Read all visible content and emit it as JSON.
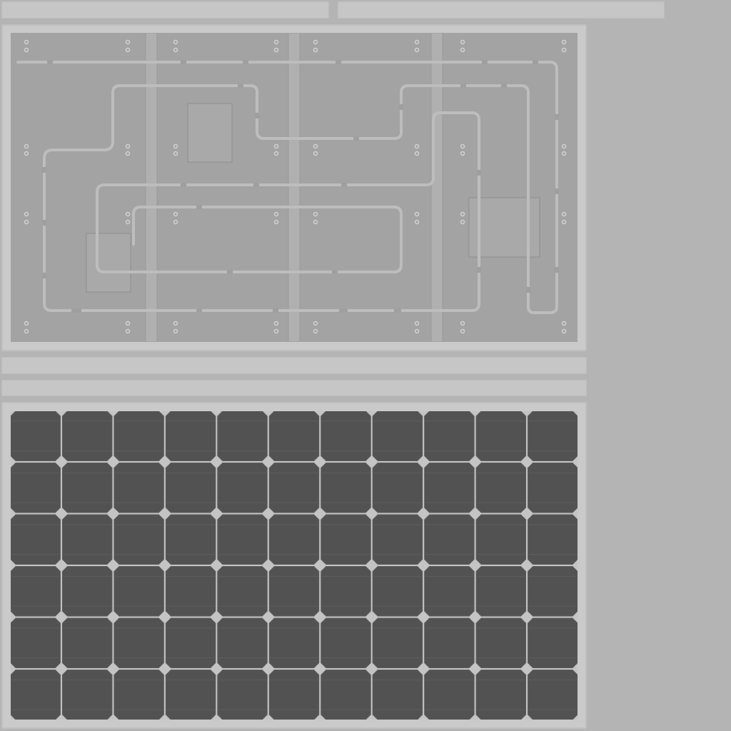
{
  "texture": {
    "background_color": "#b4b4b4",
    "frame_color": "#cacaca",
    "backplate_color": "#a3a3a3",
    "rail_color": "#b2b2b2",
    "conduit_color": "#bcbcbc",
    "cell_color": "#525252",
    "cell_grid_color": "#c4c4c4"
  },
  "solar_cells": {
    "rows": 6,
    "columns": 11
  }
}
